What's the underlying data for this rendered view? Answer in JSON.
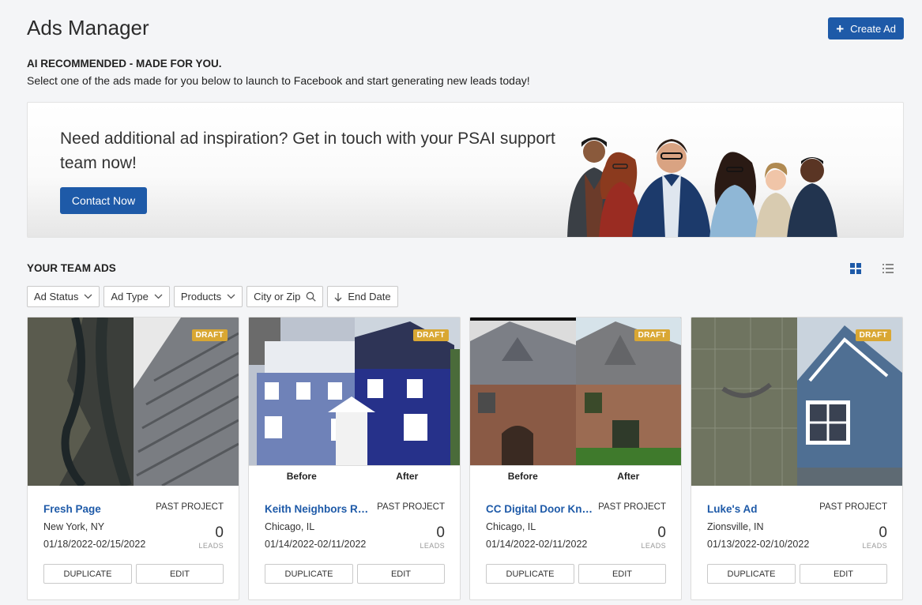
{
  "header": {
    "title": "Ads Manager",
    "create_label": "Create Ad"
  },
  "ai": {
    "heading": "AI RECOMMENDED - MADE FOR YOU.",
    "subtext": "Select one of the ads made for you below to launch to Facebook and start generating new leads today!"
  },
  "banner": {
    "text": "Need additional ad inspiration? Get in touch with your PSAI support team now!",
    "button": "Contact Now"
  },
  "team": {
    "title": "YOUR TEAM ADS",
    "filters": [
      "Ad Status",
      "Ad Type",
      "Products",
      "City or Zip",
      "End Date"
    ]
  },
  "colors": {
    "primary": "#1e5aa8",
    "draft": "#d9a733",
    "background": "#f4f5f7"
  },
  "icons": {
    "grid_view": "grid-icon",
    "list_view": "list-icon",
    "search": "search-icon",
    "sort": "arrow-down-icon",
    "dropdown": "chevron-down-icon"
  },
  "cards": [
    {
      "badge": "DRAFT",
      "name": "Fresh Page",
      "status": "PAST PROJECT",
      "location": "New York, NY",
      "dates": "01/18/2022-02/15/2022",
      "leads_count": "0",
      "leads_label": "LEADS",
      "duplicate": "DUPLICATE",
      "edit": "EDIT",
      "before": "",
      "after": ""
    },
    {
      "badge": "DRAFT",
      "name": "Keith Neighbors Referral",
      "status": "PAST PROJECT",
      "location": "Chicago, IL",
      "dates": "01/14/2022-02/11/2022",
      "leads_count": "0",
      "leads_label": "LEADS",
      "duplicate": "DUPLICATE",
      "edit": "EDIT",
      "before": "Before",
      "after": "After"
    },
    {
      "badge": "DRAFT",
      "name": "CC Digital Door Knock Ad",
      "status": "PAST PROJECT",
      "location": "Chicago, IL",
      "dates": "01/14/2022-02/11/2022",
      "leads_count": "0",
      "leads_label": "LEADS",
      "duplicate": "DUPLICATE",
      "edit": "EDIT",
      "before": "Before",
      "after": "After"
    },
    {
      "badge": "DRAFT",
      "name": "Luke's Ad",
      "status": "PAST PROJECT",
      "location": "Zionsville, IN",
      "dates": "01/13/2022-02/10/2022",
      "leads_count": "0",
      "leads_label": "LEADS",
      "duplicate": "DUPLICATE",
      "edit": "EDIT",
      "before": "",
      "after": ""
    }
  ]
}
